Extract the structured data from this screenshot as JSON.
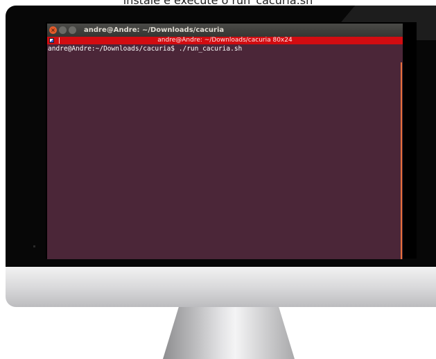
{
  "caption": "instale e execute o run_cacuria.sh",
  "terminal": {
    "window_title": "andre@Andre: ~/Downloads/cacuria",
    "tmux_title": "andre@Andre: ~/Downloads/cacuria 80x24",
    "prompt": "andre@Andre:~/Downloads/cacuria$",
    "command": " ./run_cacuria.sh",
    "buttons": {
      "close": "×",
      "minimize": "",
      "maximize": ""
    }
  },
  "colors": {
    "terminal_background": "#4b2638",
    "titlebar": "#3e3e3b",
    "status_bar": "#d20c11",
    "bezel": "#070707"
  }
}
